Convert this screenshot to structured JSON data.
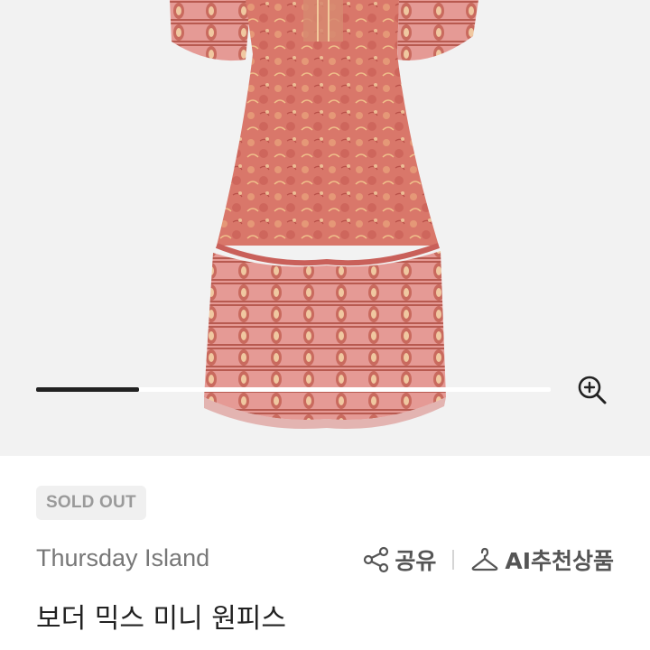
{
  "gallery": {
    "image_alt": "product-dress-photo",
    "progress_fraction": 0.2,
    "zoom_icon": "zoom-in-icon"
  },
  "product": {
    "status_badge": "SOLD OUT",
    "brand": "Thursday Island",
    "title": "보더 믹스 미니 원피스"
  },
  "actions": {
    "share_label": "공유",
    "share_icon": "share-icon",
    "ai_label": "AI추천상품",
    "ai_icon": "hanger-icon"
  },
  "colors": {
    "accent_dark": "#222222",
    "badge_bg": "#f0f0f0",
    "gallery_bg": "#f2f2f2",
    "dress_main": "#d9776a"
  }
}
